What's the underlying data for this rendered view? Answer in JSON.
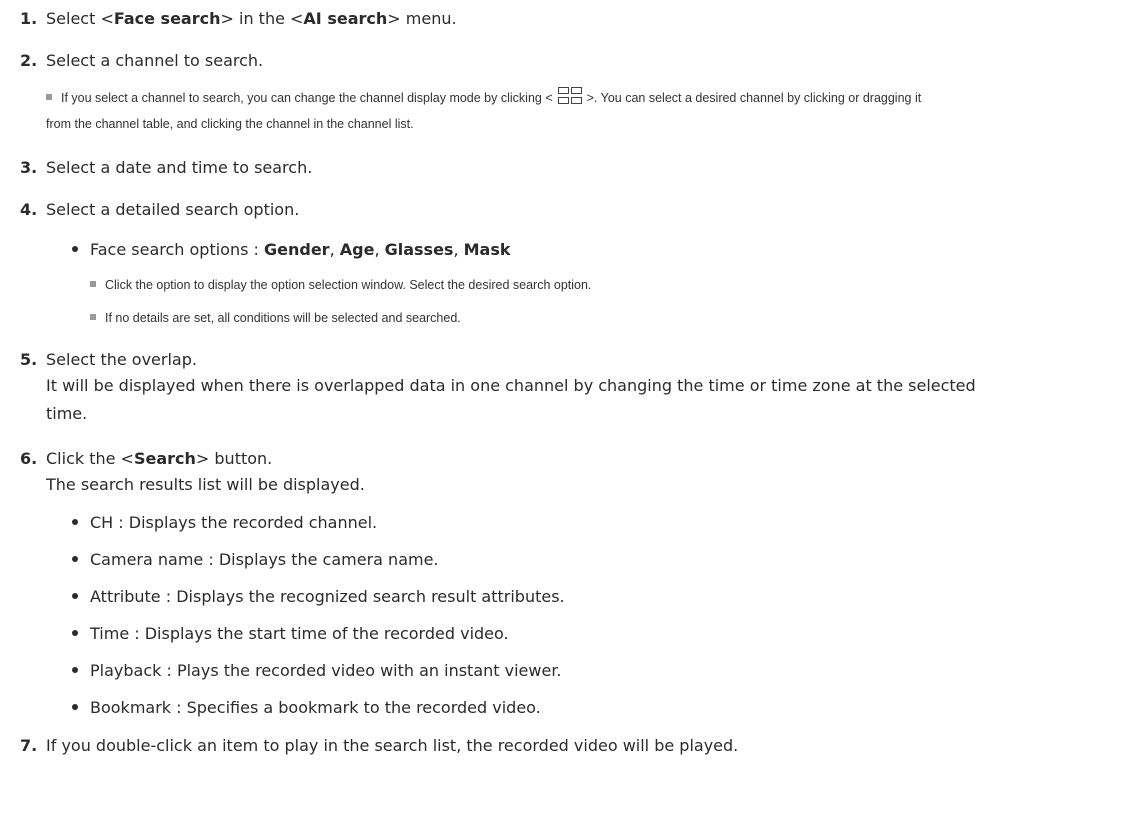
{
  "steps": [
    {
      "num": "1.",
      "pre": "Select <",
      "b1": "Face search",
      "mid": "> in the <",
      "b2": "AI search",
      "post": "> menu."
    },
    {
      "num": "2.",
      "text": "Select a channel to search."
    },
    {
      "num": "3.",
      "text": "Select a date and time to search."
    },
    {
      "num": "4.",
      "text": "Select a detailed search option."
    },
    {
      "num": "5.",
      "text": "Select the overlap."
    },
    {
      "num": "6.",
      "pre": "Click the <",
      "b1": "Search",
      "post": "> button."
    },
    {
      "num": "7.",
      "text": "If you double-click an item to play in the search list, the recorded video will be played."
    }
  ],
  "step2_note": {
    "line1_pre": "If you select a channel to search, you can change the channel display mode by clicking <",
    "line1_post": ">. You can select a desired channel by clicking or dragging it",
    "line2": "from the channel table, and clicking the channel in the channel list."
  },
  "step4": {
    "options_label": "Face search options : ",
    "opt_gender": "Gender",
    "opt_age": "Age",
    "opt_glasses": "Glasses",
    "opt_mask": "Mask",
    "sep": ", ",
    "note1": "Click the option to display the option selection window. Select the desired search option.",
    "note2": "If no details are set, all conditions will be selected and searched."
  },
  "step5_desc": {
    "line1": "It will be displayed when there is overlapped data in one channel by changing the time or time zone at the selected",
    "line2": "time."
  },
  "step6_desc": "The search results list will be displayed.",
  "result_items": [
    "CH : Displays the recorded channel.",
    "Camera name : Displays the camera name.",
    "Attribute : Displays the recognized search result attributes.",
    "Time : Displays the start time of the recorded video.",
    "Playback : Plays the recorded video with an instant viewer.",
    "Bookmark : Specifies a bookmark to the recorded video."
  ]
}
